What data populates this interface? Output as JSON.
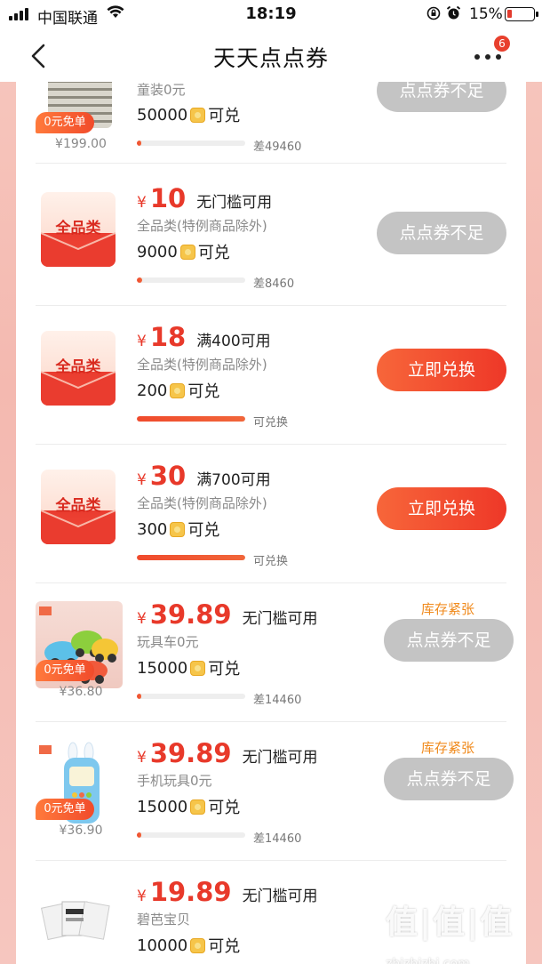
{
  "status_bar": {
    "carrier": "中国联通",
    "time": "18:19",
    "battery_pct": "15%"
  },
  "nav": {
    "title": "天天点点券",
    "badge_count": "6"
  },
  "items": [
    {
      "subtitle": "童装0元",
      "points": "50000",
      "points_suffix": "可兑",
      "free_tag": "0元免单",
      "orig_price": "¥199.00",
      "progress": 0.02,
      "progress_note": "差49460",
      "button": "点点券不足"
    },
    {
      "yen": "¥",
      "price": "10",
      "condition": "无门槛可用",
      "thumb_label": "全品类",
      "subtitle": "全品类(特例商品除外)",
      "points": "9000",
      "points_suffix": "可兑",
      "progress": 0.05,
      "progress_note": "差8460",
      "button": "点点券不足"
    },
    {
      "yen": "¥",
      "price": "18",
      "condition": "满400可用",
      "thumb_label": "全品类",
      "subtitle": "全品类(特例商品除外)",
      "points": "200",
      "points_suffix": "可兑",
      "progress": 1.0,
      "progress_note": "可兑换",
      "button": "立即兑换"
    },
    {
      "yen": "¥",
      "price": "30",
      "condition": "满700可用",
      "thumb_label": "全品类",
      "subtitle": "全品类(特例商品除外)",
      "points": "300",
      "points_suffix": "可兑",
      "progress": 1.0,
      "progress_note": "可兑换",
      "button": "立即兑换"
    },
    {
      "yen": "¥",
      "price": "39.89",
      "condition": "无门槛可用",
      "subtitle": "玩具车0元",
      "points": "15000",
      "points_suffix": "可兑",
      "free_tag": "0元免单",
      "orig_price": "¥36.80",
      "stock": "库存紧张",
      "progress": 0.03,
      "progress_note": "差14460",
      "button": "点点券不足"
    },
    {
      "yen": "¥",
      "price": "39.89",
      "condition": "无门槛可用",
      "subtitle": "手机玩具0元",
      "points": "15000",
      "points_suffix": "可兑",
      "free_tag": "0元免单",
      "orig_price": "¥36.90",
      "stock": "库存紧张",
      "progress": 0.03,
      "progress_note": "差14460",
      "button": "点点券不足"
    },
    {
      "yen": "¥",
      "price": "19.89",
      "condition": "无门槛可用",
      "subtitle": "碧芭宝贝",
      "points": "10000",
      "points_suffix": "可兑"
    }
  ],
  "watermark": {
    "big": "值|值|值",
    "small": "值得买 什么值得买",
    "url": "zhizhizhi.com"
  },
  "colors": {
    "accent": "#e8392a",
    "button_red": "#ee3828",
    "button_gray": "#c4c4c4",
    "stock": "#f08a1c"
  }
}
